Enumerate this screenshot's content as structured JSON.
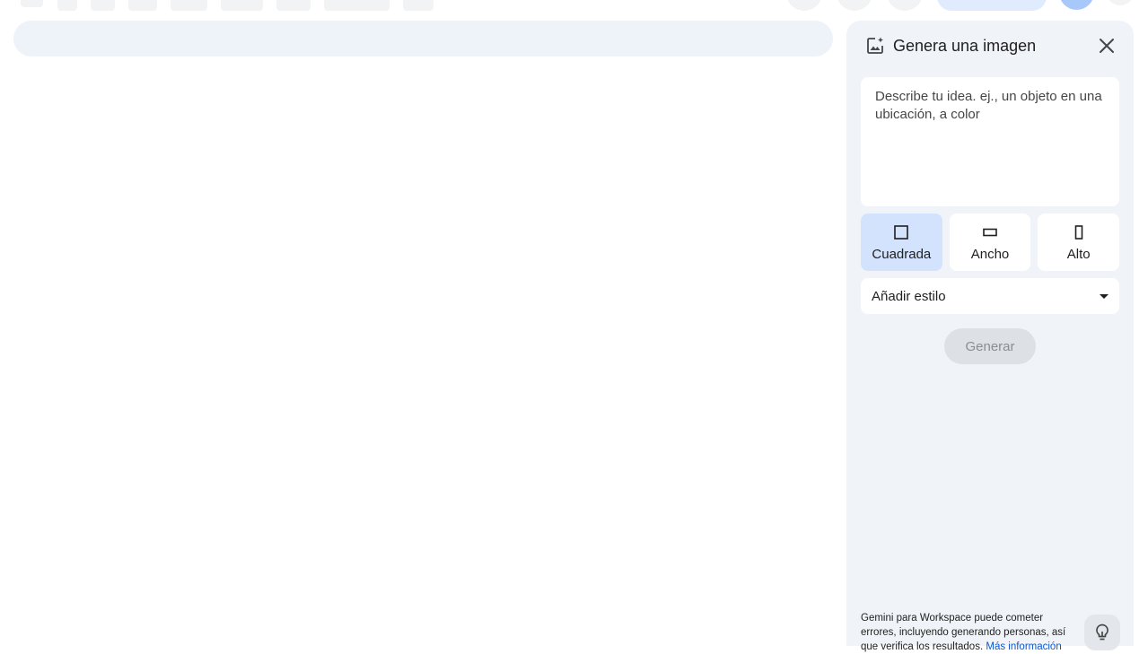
{
  "panel": {
    "title": "Genera una imagen",
    "prompt_placeholder": "Describe tu idea. ej., un objeto en una ubicación, a color",
    "aspect_options": [
      {
        "label": "Cuadrada",
        "icon": "square-icon",
        "selected": true
      },
      {
        "label": "Ancho",
        "icon": "landscape-icon",
        "selected": false
      },
      {
        "label": "Alto",
        "icon": "portrait-icon",
        "selected": false
      }
    ],
    "style_label": "Añadir estilo",
    "generate_label": "Generar",
    "disclaimer_text": "Gemini para Workspace puede cometer errores, incluyendo generando personas, así que verifica los resultados.",
    "disclaimer_link": "Más información"
  },
  "colors": {
    "panel_bg": "#f0f4f9",
    "selected_bg": "#d3e3fd",
    "link": "#0b57d0",
    "button_disabled_bg": "#dde1e6"
  }
}
